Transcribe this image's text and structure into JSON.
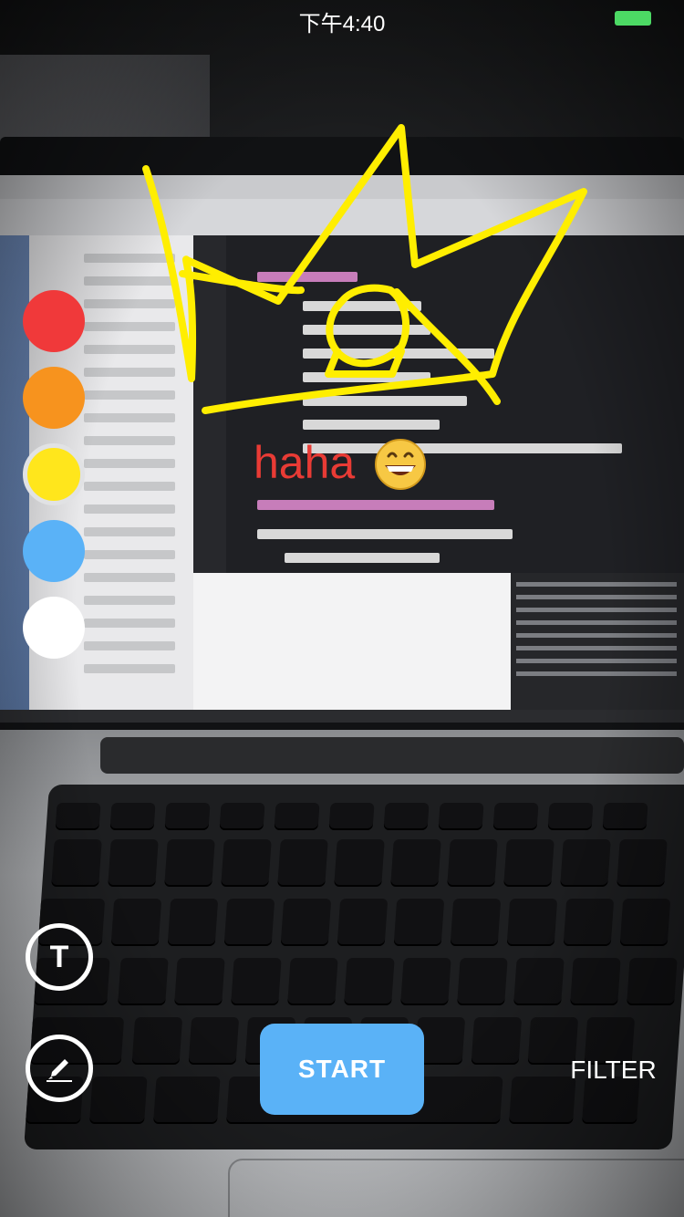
{
  "status_bar": {
    "time": "下午4:40",
    "battery_color": "#4cd964"
  },
  "canvas": {
    "overlay_text": "haha",
    "overlay_text_color": "#e93b35",
    "emoji_icon": "grinning-face-icon",
    "stroke_color": "#ffee00"
  },
  "palette": {
    "colors": [
      {
        "name": "red",
        "hex": "#f0393a"
      },
      {
        "name": "orange",
        "hex": "#f7931e"
      },
      {
        "name": "yellow",
        "hex": "#ffe61c",
        "selected": true
      },
      {
        "name": "blue",
        "hex": "#5ab2f7"
      },
      {
        "name": "white",
        "hex": "#ffffff"
      }
    ]
  },
  "tools": {
    "text_tool_glyph": "T",
    "text_tool_icon": "text-icon",
    "draw_tool_icon": "pencil-icon"
  },
  "actions": {
    "start_label": "START",
    "filter_label": "FILTER",
    "start_color": "#5ab2f7"
  }
}
